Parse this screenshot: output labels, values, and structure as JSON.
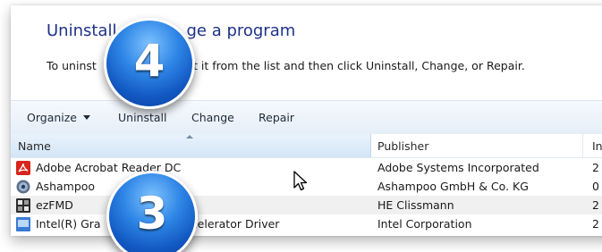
{
  "heading": {
    "left": "Uninstall",
    "right": "ge a program"
  },
  "instructions": {
    "left": "To uninst",
    "right": "select it from the list and then click Uninstall, Change, or Repair."
  },
  "toolbar": {
    "organize_label": "Organize",
    "uninstall_label": "Uninstall",
    "change_label": "Change",
    "repair_label": "Repair"
  },
  "columns": {
    "name": "Name",
    "publisher": "Publisher",
    "installed": "In"
  },
  "rows": [
    {
      "name": "Adobe Acrobat Reader DC",
      "publisher": "Adobe Systems Incorporated",
      "installed": "2",
      "icon": "acrobat-icon"
    },
    {
      "name": "Ashampoo",
      "publisher": "Ashampoo GmbH & Co. KG",
      "installed": "0",
      "icon": "ashampoo-icon"
    },
    {
      "name": "ezFMD",
      "publisher": "HE Clissmann",
      "installed": "2",
      "icon": "ezfmd-icon"
    },
    {
      "name": "Intel(R) Gra",
      "name_tail": "Accelerator Driver",
      "publisher": "Intel Corporation",
      "installed": "2",
      "icon": "intel-graphics-icon"
    }
  ],
  "badges": {
    "step_top": "4",
    "step_bottom": "3"
  },
  "colors": {
    "heading_blue": "#1e3287",
    "badge_blue": "#1f6fd6",
    "toolbar_top": "#f6f9fd",
    "toolbar_bottom": "#e6eef8",
    "selected_row": "#f0f0f0"
  }
}
